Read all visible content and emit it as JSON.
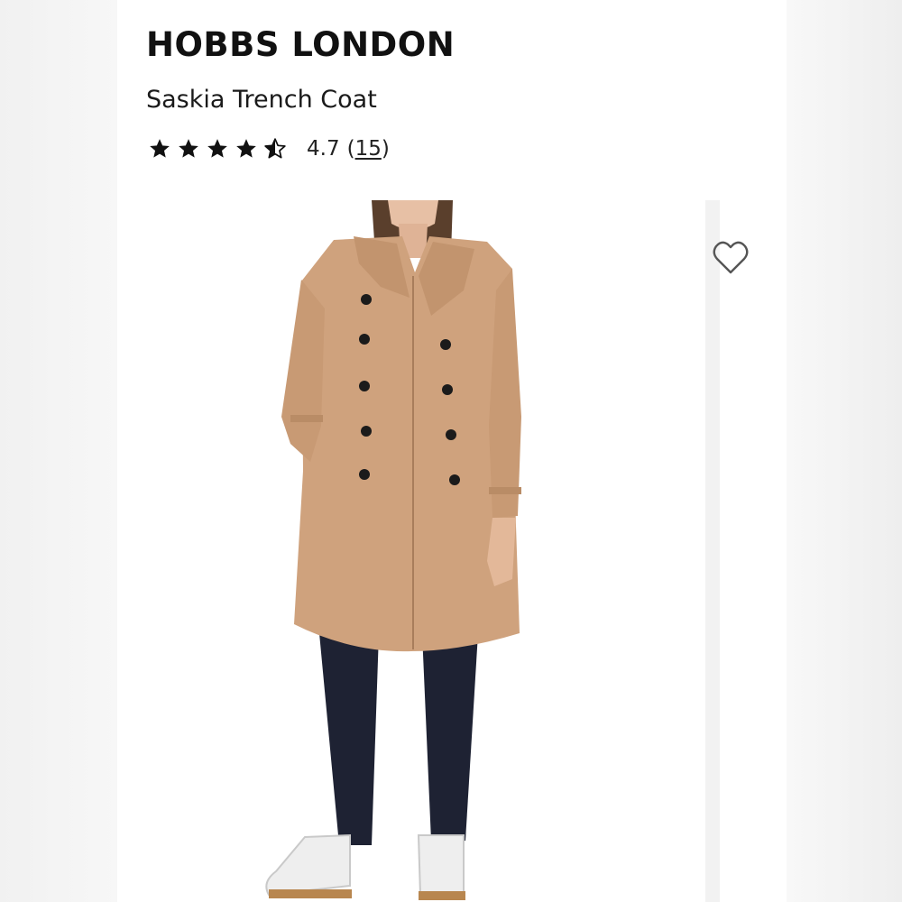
{
  "product": {
    "brand": "HOBBS LONDON",
    "name": "Saskia Trench Coat",
    "rating": {
      "stars_filled_fraction": 0.94,
      "score": "4.7",
      "count": "15",
      "open_paren": "(",
      "close_paren": ")"
    }
  },
  "image": {
    "alt": "Model wearing camel double-breasted trench coat",
    "coat_color": "#cfa27d",
    "icon": "heart-outline-icon"
  },
  "colors": {
    "star": "#111111",
    "page_background": "#ffffff",
    "outer_background": "#f4f4f4"
  }
}
